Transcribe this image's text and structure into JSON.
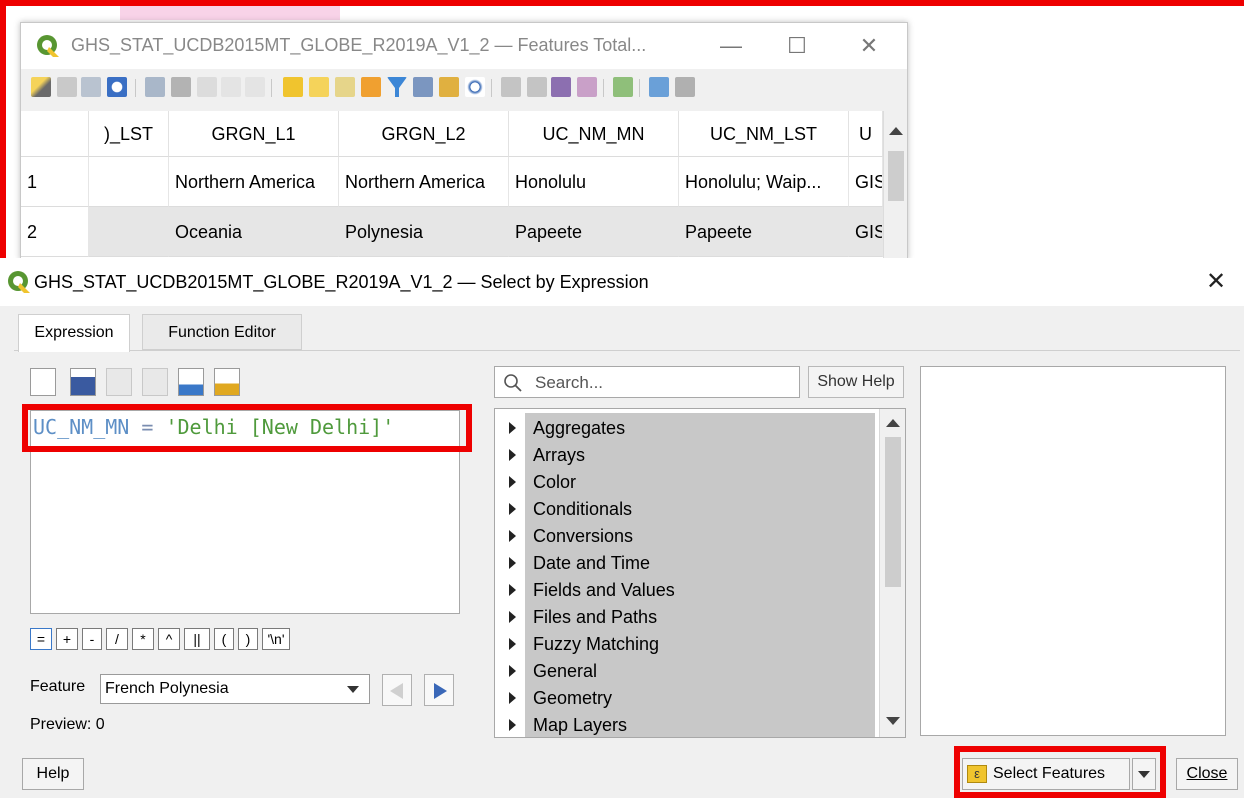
{
  "attribute_table": {
    "title": "GHS_STAT_UCDB2015MT_GLOBE_R2019A_V1_2 — Features Total...",
    "window_controls": {
      "minimize": "—",
      "maximize": "☐",
      "close": "✕"
    },
    "columns": [
      ")_LST",
      "GRGN_L1",
      "GRGN_L2",
      "UC_NM_MN",
      "UC_NM_LST",
      "U"
    ],
    "rows": [
      {
        "index": "1",
        "cells": [
          "",
          "Northern America",
          "Northern America",
          "Honolulu",
          "Honolulu; Waip...",
          "GIS"
        ]
      },
      {
        "index": "2",
        "cells": [
          "",
          "Oceania",
          "Polynesia",
          "Papeete",
          "Papeete",
          "GIS"
        ]
      }
    ]
  },
  "dialog": {
    "title": "GHS_STAT_UCDB2015MT_GLOBE_R2019A_V1_2 — Select by Expression",
    "close": "✕",
    "tabs": [
      {
        "label": "Expression"
      },
      {
        "label": "Function Editor"
      }
    ],
    "expression": {
      "field": "UC_NM_MN",
      "operator": "=",
      "string": "'Delhi [New Delhi]'"
    },
    "operators": [
      "=",
      "+",
      "-",
      "/",
      "*",
      "^",
      "||",
      "(",
      ")",
      "'\\n'"
    ],
    "feature": {
      "label": "Feature",
      "value": "French Polynesia"
    },
    "preview": "Preview: 0",
    "search": {
      "placeholder": "Search...",
      "show_help": "Show Help"
    },
    "function_groups": [
      "Aggregates",
      "Arrays",
      "Color",
      "Conditionals",
      "Conversions",
      "Date and Time",
      "Fields and Values",
      "Files and Paths",
      "Fuzzy Matching",
      "General",
      "Geometry",
      "Map Layers"
    ],
    "buttons": {
      "help": "Help",
      "select_features": "Select Features",
      "close": "Close"
    }
  },
  "colors": {
    "highlight": "#ee0000",
    "field": "#5d8fc6",
    "string": "#4f9a3c",
    "qgis_green": "#589632",
    "qgis_yellow": "#f0c42e"
  }
}
